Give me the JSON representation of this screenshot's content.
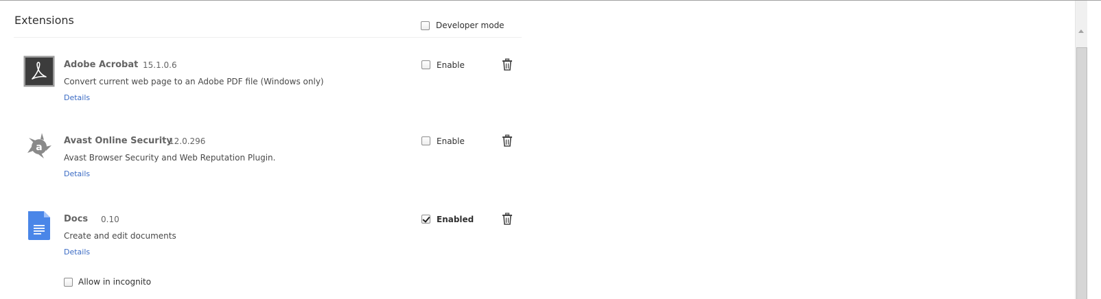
{
  "header": {
    "title": "Extensions",
    "developer_mode_label": "Developer mode",
    "developer_mode_checked": false
  },
  "extensions": [
    {
      "name": "Adobe Acrobat",
      "version": "15.1.0.6",
      "description": "Convert current web page to an Adobe PDF file (Windows only)",
      "details_label": "Details",
      "enable_label": "Enable",
      "enabled": false,
      "icon": "adobe-acrobat-icon"
    },
    {
      "name": "Avast Online Security",
      "version": "12.0.296",
      "description": "Avast Browser Security and Web Reputation Plugin.",
      "details_label": "Details",
      "enable_label": "Enable",
      "enabled": false,
      "icon": "avast-icon"
    },
    {
      "name": "Docs",
      "version": "0.10",
      "description": "Create and edit documents",
      "details_label": "Details",
      "enable_label": "Enabled",
      "enabled": true,
      "icon": "google-docs-icon",
      "incognito_label": "Allow in incognito",
      "incognito_checked": false
    }
  ],
  "colors": {
    "link": "#3b6bc4",
    "name_text": "#646464",
    "docs_blue": "#4a86e8",
    "acrobat_bg": "#3c3c3c",
    "avast_gray": "#8a8a8a"
  }
}
